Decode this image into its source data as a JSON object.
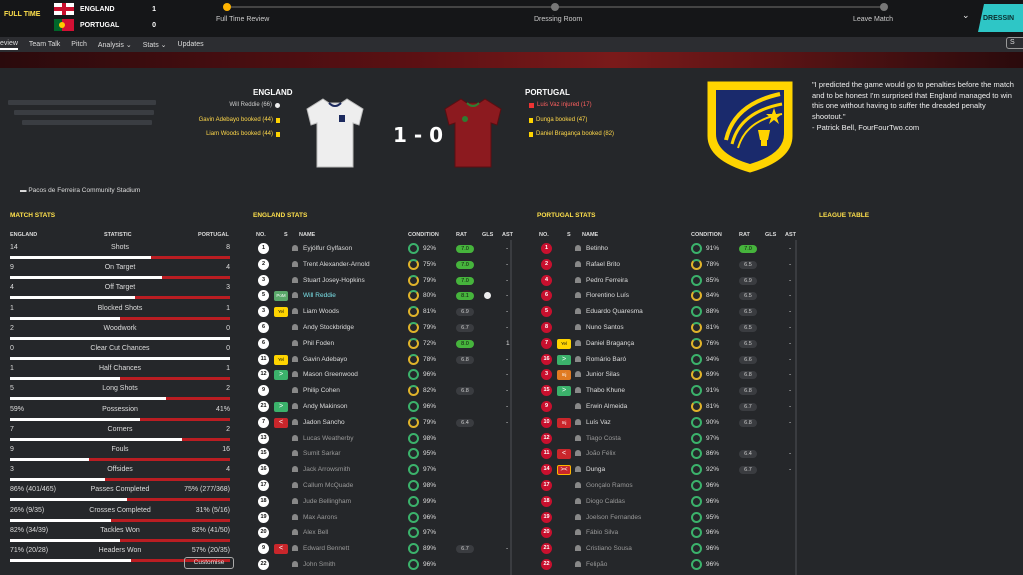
{
  "topbar": {
    "status": "FULL TIME",
    "home_name": "ENGLAND",
    "home_score": "1",
    "away_name": "PORTUGAL",
    "away_score": "0",
    "stages": [
      "Full Time Review",
      "Dressing Room",
      "Leave Match"
    ],
    "continue_label": "DRESSIN",
    "progress": 0.0
  },
  "nav": {
    "tabs": [
      "eview",
      "Team Talk",
      "Pitch",
      "Analysis ⌄",
      "Stats ⌄",
      "Updates"
    ],
    "search_label": "S"
  },
  "match": {
    "home": "ENGLAND",
    "away": "PORTUGAL",
    "score": "1 - 0",
    "stadium": "Pacos de Ferreira Community Stadium",
    "home_events": [
      {
        "text": "Will Reddie (66)",
        "type": "goal"
      },
      {
        "text": "Gavin Adebayo booked (44)",
        "type": "yellow"
      },
      {
        "text": "Liam Woods booked (44)",
        "type": "yellow"
      }
    ],
    "away_events": [
      {
        "text": "Luis Vaz injured (17)",
        "type": "injury"
      },
      {
        "text": "Dunga booked (47)",
        "type": "yellow"
      },
      {
        "text": "Daniel Bragança booked (82)",
        "type": "yellow"
      }
    ]
  },
  "quote": {
    "text": "\"I predicted the game would go to penalties before the match and to be honest I'm surprised that England managed to win this one without having to suffer the dreaded penalty shootout.\"",
    "source": "- Patrick Bell, FourFourTwo.com"
  },
  "match_stats": {
    "title": "MATCH STATS",
    "col_home": "ENGLAND",
    "col_stat": "STATISTIC",
    "col_away": "PORTUGAL",
    "customise": "Customise",
    "rows": [
      {
        "home": "14",
        "name": "Shots",
        "away": "8",
        "share": 0.64
      },
      {
        "home": "9",
        "name": "On Target",
        "away": "4",
        "share": 0.69
      },
      {
        "home": "4",
        "name": "Off Target",
        "away": "3",
        "share": 0.57
      },
      {
        "home": "1",
        "name": "Blocked Shots",
        "away": "1",
        "share": 0.5
      },
      {
        "home": "2",
        "name": "Woodwork",
        "away": "0",
        "share": 1.0
      },
      {
        "home": "0",
        "name": "Clear Cut Chances",
        "away": "0",
        "share": 1.0
      },
      {
        "home": "1",
        "name": "Half Chances",
        "away": "1",
        "share": 0.5
      },
      {
        "home": "5",
        "name": "Long Shots",
        "away": "2",
        "share": 0.71
      },
      {
        "home": "59%",
        "name": "Possession",
        "away": "41%",
        "share": 0.59
      },
      {
        "home": "7",
        "name": "Corners",
        "away": "2",
        "share": 0.78
      },
      {
        "home": "9",
        "name": "Fouls",
        "away": "16",
        "share": 0.36
      },
      {
        "home": "3",
        "name": "Offsides",
        "away": "4",
        "share": 0.43
      },
      {
        "home": "86% (401/465)",
        "name": "Passes Completed",
        "away": "75% (277/368)",
        "share": 0.53
      },
      {
        "home": "26% (9/35)",
        "name": "Crosses Completed",
        "away": "31% (5/16)",
        "share": 0.46
      },
      {
        "home": "82% (34/39)",
        "name": "Tackles Won",
        "away": "82% (41/50)",
        "share": 0.5
      },
      {
        "home": "71% (20/28)",
        "name": "Headers Won",
        "away": "57% (20/35)",
        "share": 0.55
      }
    ]
  },
  "england_stats": {
    "title": "ENGLAND STATS",
    "headers": [
      "NO.",
      "S",
      "NAME",
      "CONDITION",
      "RAT",
      "GLS",
      "AST"
    ],
    "players": [
      {
        "no": "1",
        "badge": "",
        "name": "Eyjólfur Gylfason",
        "cond": "92%",
        "rat": "7.0",
        "rat_hi": true,
        "ast": "-",
        "dim": false
      },
      {
        "no": "2",
        "badge": "",
        "name": "Trent Alexander-Arnold",
        "cond": "75%",
        "rat": "7.0",
        "rat_hi": true,
        "ast": "-",
        "dim": false
      },
      {
        "no": "3",
        "badge": "",
        "name": "Stuart Josey-Hopkins",
        "cond": "79%",
        "rat": "7.0",
        "rat_hi": true,
        "ast": "-",
        "dim": false
      },
      {
        "no": "5",
        "badge": "PoM",
        "name": "Will Reddie",
        "cond": "80%",
        "rat": "8.1",
        "rat_hi": true,
        "ast": "-",
        "dim": false,
        "goal": true,
        "hl": true
      },
      {
        "no": "3",
        "badge": "Yel",
        "name": "Liam Woods",
        "cond": "81%",
        "rat": "6.9",
        "rat_hi": false,
        "ast": "-",
        "dim": false
      },
      {
        "no": "6",
        "badge": "",
        "name": "Andy Stockbridge",
        "cond": "79%",
        "rat": "6.7",
        "rat_hi": false,
        "ast": "-",
        "dim": false
      },
      {
        "no": "6",
        "badge": "",
        "name": "Phil Foden",
        "cond": "72%",
        "rat": "8.0",
        "rat_hi": true,
        "ast": "1",
        "dim": false
      },
      {
        "no": "11",
        "badge": "Yel",
        "name": "Gavin Adebayo",
        "cond": "78%",
        "rat": "6.8",
        "rat_hi": false,
        "ast": "-",
        "dim": false
      },
      {
        "no": "12",
        "badge": ">",
        "name": "Mason Greenwood",
        "cond": "96%",
        "rat": "",
        "rat_hi": false,
        "ast": "-",
        "dim": false
      },
      {
        "no": "9",
        "badge": "",
        "name": "Philip Cohen",
        "cond": "82%",
        "rat": "6.8",
        "rat_hi": false,
        "ast": "-",
        "dim": false
      },
      {
        "no": "21",
        "badge": ">",
        "name": "Andy Makinson",
        "cond": "96%",
        "rat": "",
        "rat_hi": false,
        "ast": "-",
        "dim": false
      },
      {
        "no": "7",
        "badge": "<",
        "name": "Jadon Sancho",
        "cond": "79%",
        "rat": "6.4",
        "rat_hi": false,
        "ast": "-",
        "dim": false
      },
      {
        "no": "13",
        "badge": "",
        "name": "Lucas Weatherby",
        "cond": "98%",
        "rat": "",
        "rat_hi": false,
        "ast": "",
        "dim": true
      },
      {
        "no": "15",
        "badge": "",
        "name": "Sumit Sarkar",
        "cond": "95%",
        "rat": "",
        "rat_hi": false,
        "ast": "",
        "dim": true
      },
      {
        "no": "16",
        "badge": "",
        "name": "Jack Arrowsmith",
        "cond": "97%",
        "rat": "",
        "rat_hi": false,
        "ast": "",
        "dim": true
      },
      {
        "no": "17",
        "badge": "",
        "name": "Callum McQuade",
        "cond": "98%",
        "rat": "",
        "rat_hi": false,
        "ast": "",
        "dim": true
      },
      {
        "no": "18",
        "badge": "",
        "name": "Jude Bellingham",
        "cond": "99%",
        "rat": "",
        "rat_hi": false,
        "ast": "",
        "dim": true
      },
      {
        "no": "19",
        "badge": "",
        "name": "Max Aarons",
        "cond": "96%",
        "rat": "",
        "rat_hi": false,
        "ast": "",
        "dim": true
      },
      {
        "no": "20",
        "badge": "",
        "name": "Alex Bell",
        "cond": "97%",
        "rat": "",
        "rat_hi": false,
        "ast": "",
        "dim": true
      },
      {
        "no": "9",
        "badge": "<",
        "name": "Edward Bennett",
        "cond": "89%",
        "rat": "6.7",
        "rat_hi": false,
        "ast": "-",
        "dim": true
      },
      {
        "no": "22",
        "badge": "",
        "name": "John Smith",
        "cond": "96%",
        "rat": "",
        "rat_hi": false,
        "ast": "",
        "dim": true
      }
    ]
  },
  "portugal_stats": {
    "title": "PORTUGAL STATS",
    "headers": [
      "NO.",
      "S",
      "NAME",
      "CONDITION",
      "RAT",
      "GLS",
      "AST"
    ],
    "players": [
      {
        "no": "1",
        "badge": "",
        "name": "Betinho",
        "cond": "91%",
        "rat": "7.0",
        "rat_hi": true,
        "ast": "-",
        "dim": false
      },
      {
        "no": "2",
        "badge": "",
        "name": "Rafael Brito",
        "cond": "78%",
        "rat": "6.5",
        "rat_hi": false,
        "ast": "-",
        "dim": false
      },
      {
        "no": "4",
        "badge": "",
        "name": "Pedro Ferreira",
        "cond": "85%",
        "rat": "6.9",
        "rat_hi": false,
        "ast": "-",
        "dim": false
      },
      {
        "no": "6",
        "badge": "",
        "name": "Florentino Luís",
        "cond": "84%",
        "rat": "6.5",
        "rat_hi": false,
        "ast": "-",
        "dim": false
      },
      {
        "no": "5",
        "badge": "",
        "name": "Eduardo Quaresma",
        "cond": "88%",
        "rat": "6.5",
        "rat_hi": false,
        "ast": "-",
        "dim": false
      },
      {
        "no": "8",
        "badge": "",
        "name": "Nuno Santos",
        "cond": "81%",
        "rat": "6.5",
        "rat_hi": false,
        "ast": "-",
        "dim": false
      },
      {
        "no": "7",
        "badge": "Yel",
        "name": "Daniel Bragança",
        "cond": "76%",
        "rat": "6.5",
        "rat_hi": false,
        "ast": "-",
        "dim": false
      },
      {
        "no": "16",
        "badge": ">",
        "name": "Romário Baró",
        "cond": "94%",
        "rat": "6.6",
        "rat_hi": false,
        "ast": "-",
        "dim": false
      },
      {
        "no": "3",
        "badge": "Inj",
        "name": "Junior Silas",
        "cond": "69%",
        "rat": "6.8",
        "rat_hi": false,
        "ast": "-",
        "dim": false,
        "orange": true
      },
      {
        "no": "15",
        "badge": ">",
        "name": "Thabo Khune",
        "cond": "91%",
        "rat": "6.8",
        "rat_hi": false,
        "ast": "-",
        "dim": false
      },
      {
        "no": "9",
        "badge": "",
        "name": "Erwin Almeida",
        "cond": "81%",
        "rat": "6.7",
        "rat_hi": false,
        "ast": "-",
        "dim": false
      },
      {
        "no": "10",
        "badge": "Inj",
        "name": "Luís Vaz",
        "cond": "90%",
        "rat": "6.8",
        "rat_hi": false,
        "ast": "-",
        "dim": false
      },
      {
        "no": "12",
        "badge": "",
        "name": "Tiago Costa",
        "cond": "97%",
        "rat": "",
        "rat_hi": false,
        "ast": "",
        "dim": true
      },
      {
        "no": "11",
        "badge": "<",
        "name": "João Félix",
        "cond": "86%",
        "rat": "6.4",
        "rat_hi": false,
        "ast": "-",
        "dim": true
      },
      {
        "no": "14",
        "badge": "><",
        "name": "Dunga",
        "cond": "92%",
        "rat": "6.7",
        "rat_hi": false,
        "ast": "-",
        "dim": false
      },
      {
        "no": "17",
        "badge": "",
        "name": "Gonçalo Ramos",
        "cond": "96%",
        "rat": "",
        "rat_hi": false,
        "ast": "",
        "dim": true
      },
      {
        "no": "18",
        "badge": "",
        "name": "Diogo Caldas",
        "cond": "96%",
        "rat": "",
        "rat_hi": false,
        "ast": "",
        "dim": true
      },
      {
        "no": "19",
        "badge": "",
        "name": "Joelson Fernandes",
        "cond": "95%",
        "rat": "",
        "rat_hi": false,
        "ast": "",
        "dim": true
      },
      {
        "no": "20",
        "badge": "",
        "name": "Fábio Silva",
        "cond": "96%",
        "rat": "",
        "rat_hi": false,
        "ast": "",
        "dim": true
      },
      {
        "no": "21",
        "badge": "",
        "name": "Cristiano Sousa",
        "cond": "96%",
        "rat": "",
        "rat_hi": false,
        "ast": "",
        "dim": true
      },
      {
        "no": "22",
        "badge": "",
        "name": "Felipão",
        "cond": "96%",
        "rat": "",
        "rat_hi": false,
        "ast": "",
        "dim": true
      }
    ]
  },
  "league_table": {
    "title": "LEAGUE TABLE"
  },
  "colors": {
    "accent": "#ffe14c",
    "turquoise": "#2ec6c6",
    "rating_green": "#46b43c",
    "home_bar": "#ffffff",
    "away_bar": "#ba1d22"
  }
}
